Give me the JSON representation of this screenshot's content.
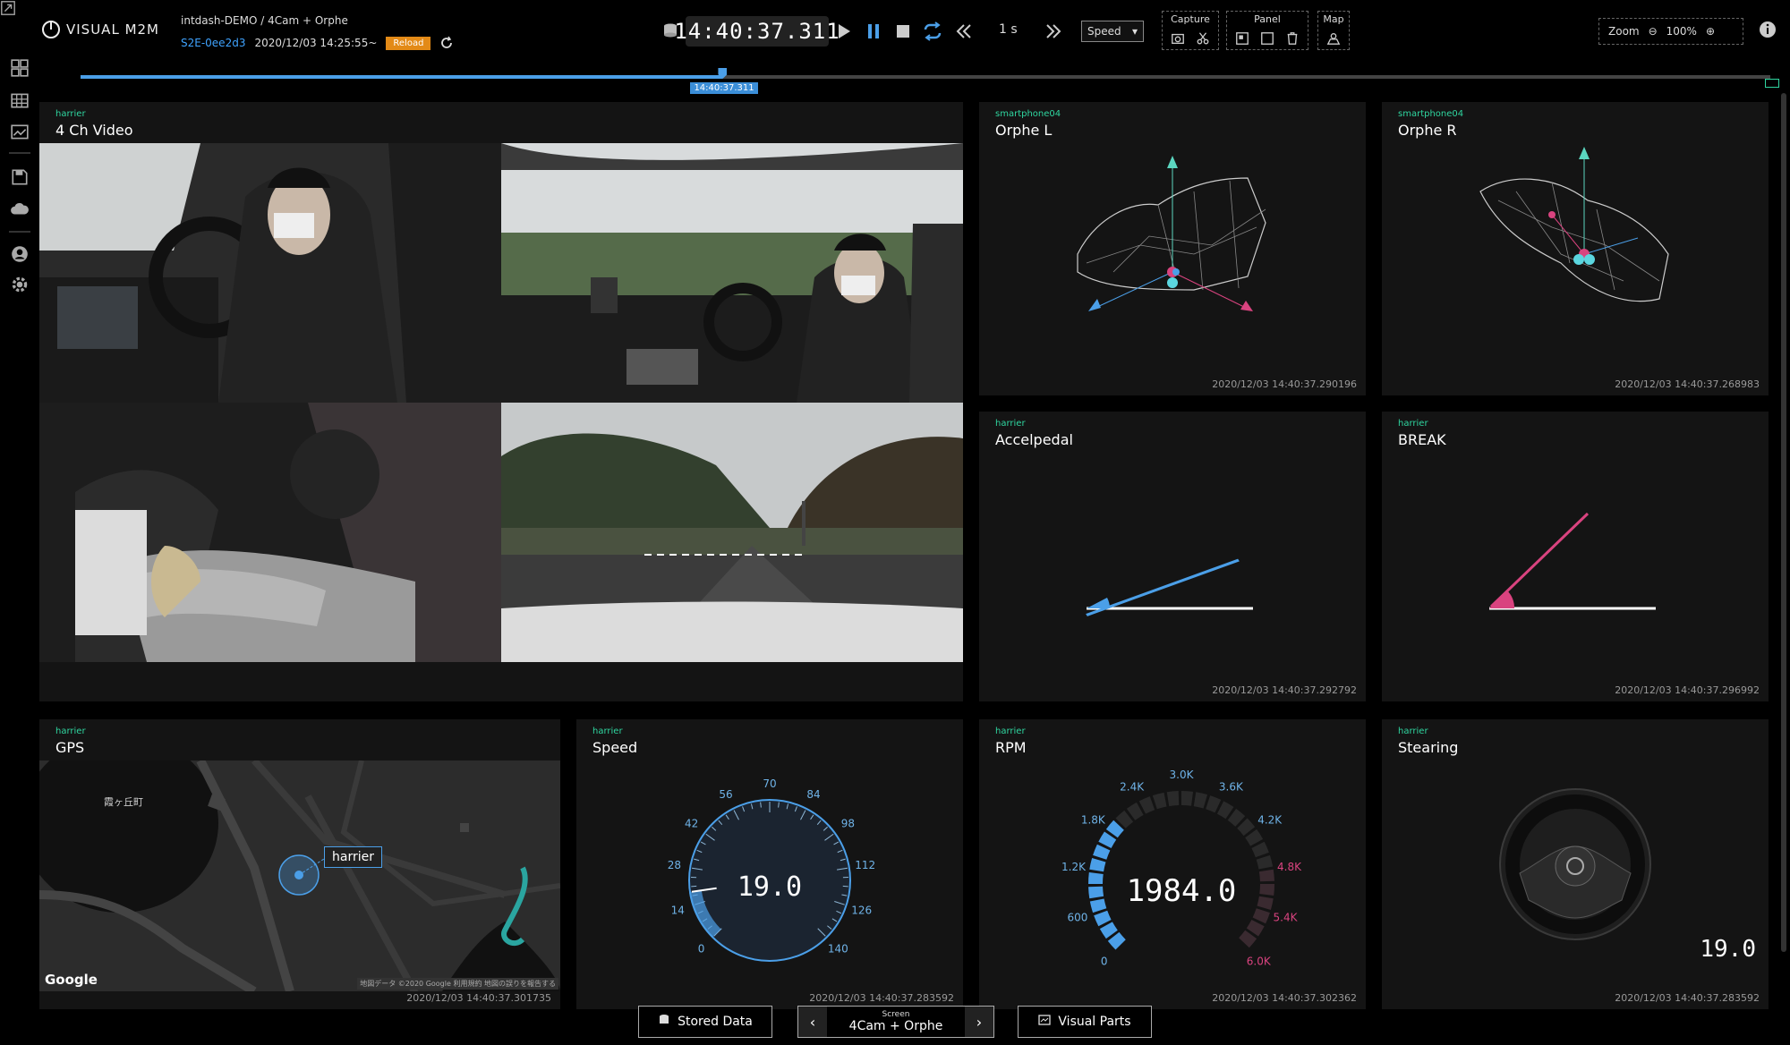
{
  "app": {
    "logo": "VISUAL M2M",
    "project": "intdash-DEMO / 4Cam + Orphe",
    "session_id": "S2E-0ee2d3",
    "session_time": "2020/12/03 14:25:55~",
    "reload": "Reload"
  },
  "player": {
    "clock": "14:40:37.311",
    "step": "1 s",
    "speed_label": "Speed",
    "timeline_progress": 0.38,
    "timeline_label": "14:40:37.311"
  },
  "groups": {
    "capture": "Capture",
    "panel": "Panel",
    "map": "Map"
  },
  "zoom": {
    "label": "Zoom",
    "value": "100%"
  },
  "panels": {
    "video": {
      "device": "harrier",
      "title": "4 Ch Video"
    },
    "orphe_l": {
      "device": "smartphone04",
      "title": "Orphe L",
      "ts": "2020/12/03 14:40:37.290196"
    },
    "orphe_r": {
      "device": "smartphone04",
      "title": "Orphe R",
      "ts": "2020/12/03 14:40:37.268983"
    },
    "accel": {
      "device": "harrier",
      "title": "Accelpedal",
      "ts": "2020/12/03 14:40:37.292792"
    },
    "brake": {
      "device": "harrier",
      "title": "BREAK",
      "ts": "2020/12/03 14:40:37.296992"
    },
    "gps": {
      "device": "harrier",
      "title": "GPS",
      "ts": "2020/12/03 14:40:37.301735",
      "map_label": "霞ヶ丘町",
      "marker": "harrier",
      "google": "Google",
      "attribution": "地図データ ©2020 Google  利用規約  地図の誤りを報告する"
    },
    "speed": {
      "device": "harrier",
      "title": "Speed",
      "ts": "2020/12/03 14:40:37.283592",
      "value": "19.0",
      "ticks": [
        "0",
        "14",
        "28",
        "42",
        "56",
        "70",
        "84",
        "98",
        "112",
        "126",
        "140"
      ]
    },
    "rpm": {
      "device": "harrier",
      "title": "RPM",
      "ts": "2020/12/03 14:40:37.302362",
      "value": "1984.0",
      "ticks": [
        "0",
        "600",
        "1.2K",
        "1.8K",
        "2.4K",
        "3.0K",
        "3.6K",
        "4.2K",
        "4.8K",
        "5.4K",
        "6.0K"
      ]
    },
    "steering": {
      "device": "harrier",
      "title": "Stearing",
      "ts": "2020/12/03 14:40:37.283592",
      "value": "19.0"
    }
  },
  "bottom": {
    "stored": "Stored Data",
    "screen_caption": "Screen",
    "screen_name": "4Cam + Orphe",
    "visual_parts": "Visual Parts"
  },
  "colors": {
    "accent": "#4b9fe8",
    "device": "#2fd6a0",
    "pink": "#d9437f",
    "reload": "#e38a17"
  }
}
